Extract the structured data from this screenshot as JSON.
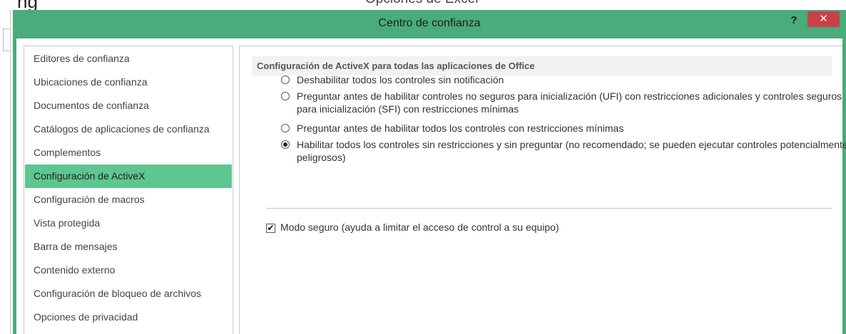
{
  "background_window": {
    "title_fragment": "Opciones de Excel",
    "left_fragment": "ng"
  },
  "dialog": {
    "title": "Centro de confianza",
    "help_label": "?",
    "close_label": "✕"
  },
  "nav": {
    "items": [
      {
        "label": "Editores de confianza"
      },
      {
        "label": "Ubicaciones de confianza"
      },
      {
        "label": "Documentos de confianza"
      },
      {
        "label": "Catálogos de aplicaciones de confianza"
      },
      {
        "label": "Complementos"
      },
      {
        "label": "Configuración de ActiveX"
      },
      {
        "label": "Configuración de macros"
      },
      {
        "label": "Vista protegida"
      },
      {
        "label": "Barra de mensajes"
      },
      {
        "label": "Contenido externo"
      },
      {
        "label": "Configuración de bloqueo de archivos"
      },
      {
        "label": "Opciones de privacidad"
      }
    ],
    "selected": "Configuración de ActiveX"
  },
  "content": {
    "section_title": "Configuración de ActiveX para todas las aplicaciones de Office",
    "options": [
      {
        "label": "Deshabilitar todos los controles sin notificación",
        "selected": false
      },
      {
        "label": "Preguntar antes de habilitar controles no seguros para inicialización (UFI) con restricciones adicionales y controles seguros para inicialización (SFI) con restricciones mínimas",
        "selected": false
      },
      {
        "label": "Preguntar antes de habilitar todos los controles con restricciones mínimas",
        "selected": false
      },
      {
        "label": "Habilitar todos los controles sin restricciones y sin preguntar (no recomendado; se pueden ejecutar controles potencialmente peligrosos)",
        "selected": true
      }
    ],
    "safe_mode": {
      "label": "Modo seguro (ayuda a limitar el acceso de control a su equipo)",
      "checked": true
    }
  },
  "colors": {
    "title_bar": "#4aab7b",
    "selected_item": "#5ec690",
    "close_button": "#c7414a"
  }
}
